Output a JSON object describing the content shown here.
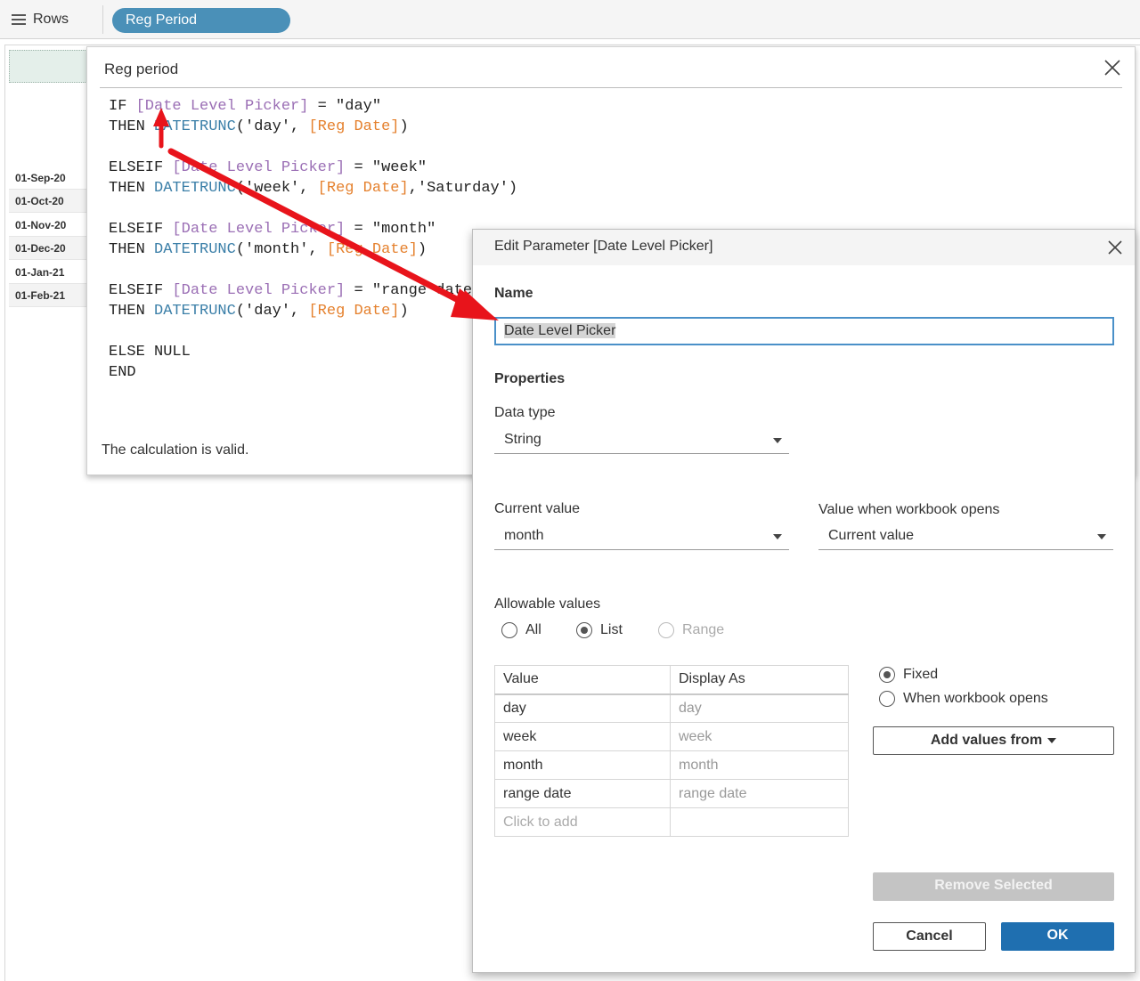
{
  "shelf": {
    "rows_label": "Rows",
    "pill_label": "Reg Period"
  },
  "row_headers": [
    "01-Sep-20",
    "01-Oct-20",
    "01-Nov-20",
    "01-Dec-20",
    "01-Jan-21",
    "01-Feb-21"
  ],
  "calc_dialog": {
    "title": "Reg period",
    "lines": {
      "l1_kw": "IF ",
      "l1_field": "[Date Level Picker]",
      "l1_rest": " = \"day\"",
      "l2_kw": "THEN ",
      "l2_fn": "DATETRUNC",
      "l2_a": "('day', ",
      "l2_ref": "[Reg Date]",
      "l2_b": ")",
      "l3_kw": "ELSEIF ",
      "l3_field": "[Date Level Picker]",
      "l3_rest": " = \"week\"",
      "l4_kw": "THEN ",
      "l4_fn": "DATETRUNC",
      "l4_a": "('week', ",
      "l4_ref": "[Reg Date]",
      "l4_b": ",'Saturday')",
      "l5_kw": "ELSEIF ",
      "l5_field": "[Date Level Picker]",
      "l5_rest": " = \"month\"",
      "l6_kw": "THEN ",
      "l6_fn": "DATETRUNC",
      "l6_a": "('month', ",
      "l6_ref": "[Reg Date]",
      "l6_b": ")",
      "l7_kw": "ELSEIF ",
      "l7_field": "[Date Level Picker]",
      "l7_rest": " = \"range date\"",
      "l8_kw": "THEN ",
      "l8_fn": "DATETRUNC",
      "l8_a": "('day', ",
      "l8_ref": "[Reg Date]",
      "l8_b": ")",
      "l9": "ELSE NULL",
      "l10": "END"
    },
    "status": "The calculation is valid."
  },
  "param_dialog": {
    "title": "Edit Parameter [Date Level Picker]",
    "name_label": "Name",
    "name_value": "Date Level Picker",
    "properties_label": "Properties",
    "data_type_label": "Data type",
    "data_type_value": "String",
    "current_value_label": "Current value",
    "current_value": "month",
    "workbook_opens_label": "Value when workbook opens",
    "workbook_opens_value": "Current value",
    "allowable_label": "Allowable values",
    "allowable_options": {
      "all": "All",
      "list": "List",
      "range": "Range"
    },
    "allowable_selected": "List",
    "table": {
      "headers": [
        "Value",
        "Display As"
      ],
      "rows": [
        [
          "day",
          "day"
        ],
        [
          "week",
          "week"
        ],
        [
          "month",
          "month"
        ],
        [
          "range date",
          "range date"
        ]
      ],
      "add_placeholder": "Click to add"
    },
    "source_options": {
      "fixed": "Fixed",
      "when_opens": "When workbook opens"
    },
    "source_selected": "Fixed",
    "add_values_label": "Add values from",
    "remove_label": "Remove Selected",
    "cancel_label": "Cancel",
    "ok_label": "OK"
  },
  "colors": {
    "pill": "#4a90b8",
    "field": "#9b6fb5",
    "function": "#3b7fa8",
    "reference": "#e5812e",
    "primary": "#1f6fb0",
    "arrow": "#e8141b"
  }
}
